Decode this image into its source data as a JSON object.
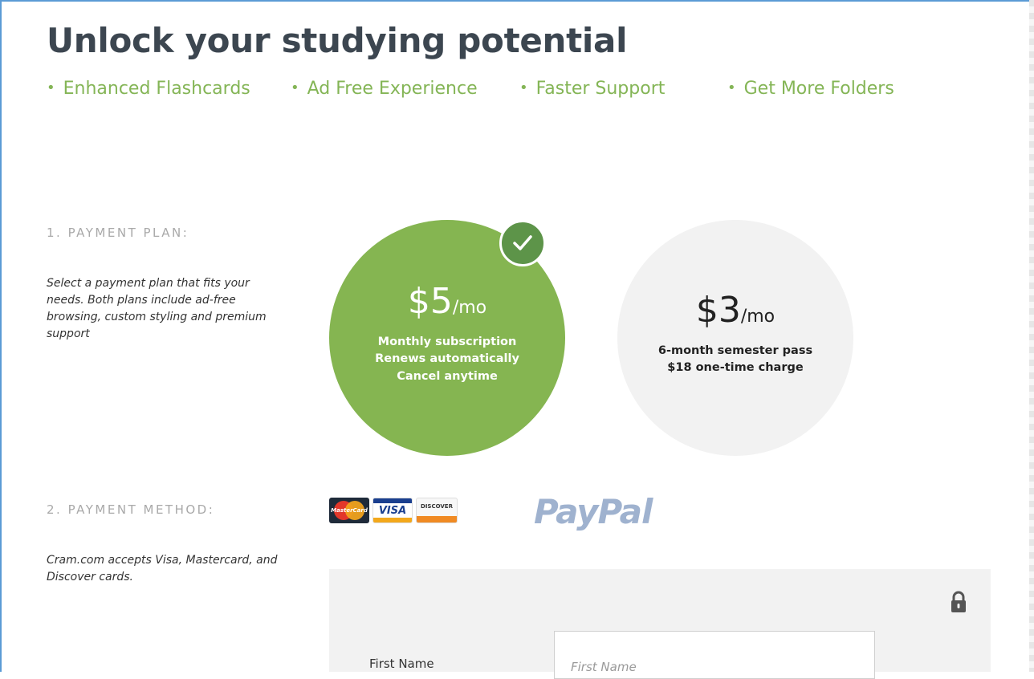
{
  "headline": "Unlock your studying potential",
  "features": [
    "Enhanced Flashcards",
    "Ad Free Experience",
    "Faster Support",
    "Get More Folders"
  ],
  "payment_plan": {
    "label": "1. PAYMENT PLAN:",
    "description": "Select a payment plan that fits your needs. Both plans include ad-free browsing, custom styling and premium support",
    "plans": [
      {
        "price": "$5",
        "period": "/mo",
        "lines": [
          "Monthly subscription",
          "Renews automatically",
          "Cancel anytime"
        ],
        "selected": true
      },
      {
        "price": "$3",
        "period": "/mo",
        "lines": [
          "6-month semester pass",
          "$18 one-time charge"
        ],
        "selected": false
      }
    ]
  },
  "payment_method": {
    "label": "2. PAYMENT METHOD:",
    "description": "Cram.com accepts Visa, Mastercard, and Discover cards.",
    "cards": {
      "mastercard": "MasterCard",
      "visa": "VISA",
      "discover": "DISCOVER"
    },
    "paypal": "PayPal"
  },
  "form": {
    "first_name_label": "First Name",
    "first_name_placeholder": "First Name"
  },
  "colors": {
    "accent_green": "#85b551",
    "feature_green": "#84b556",
    "check_green": "#5d9449",
    "heading": "#3c4650",
    "muted_label": "#a9a9a9",
    "panel_gray": "#f2f2f2"
  },
  "icons": {
    "check": "check-icon",
    "lock": "lock-icon"
  }
}
